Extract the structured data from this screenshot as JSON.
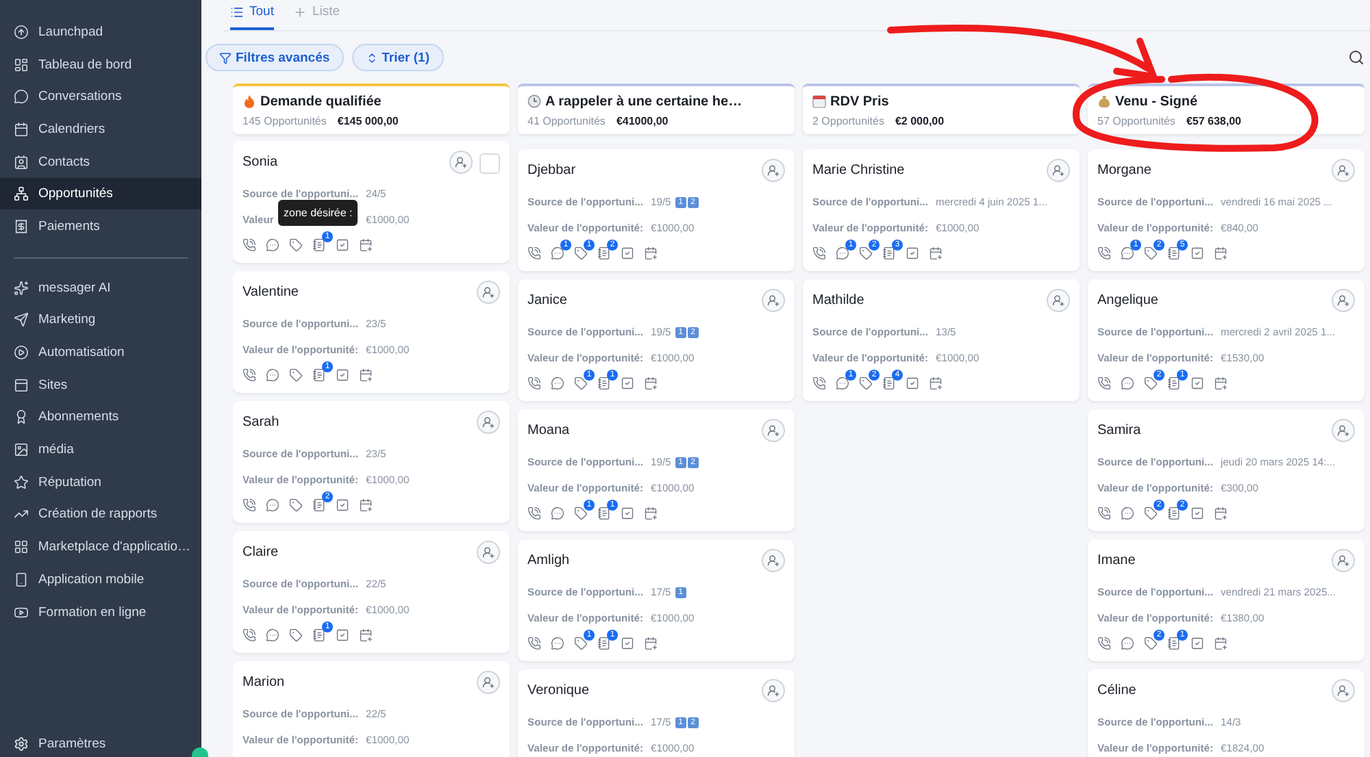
{
  "sidebar": {
    "sections": [
      {
        "items": [
          {
            "label": "Launchpad",
            "selected": false
          },
          {
            "label": "Tableau de bord",
            "selected": false
          },
          {
            "label": "Conversations",
            "selected": false
          },
          {
            "label": "Calendriers",
            "selected": false
          },
          {
            "label": "Contacts",
            "selected": false
          },
          {
            "label": "Opportunités",
            "selected": true
          },
          {
            "label": "Paiements",
            "selected": false
          }
        ]
      },
      {
        "items": [
          {
            "label": "messager AI",
            "selected": false
          },
          {
            "label": "Marketing",
            "selected": false
          },
          {
            "label": "Automatisation",
            "selected": false
          },
          {
            "label": "Sites",
            "selected": false
          },
          {
            "label": "Abonnements",
            "selected": false
          },
          {
            "label": "média",
            "selected": false
          },
          {
            "label": "Réputation",
            "selected": false
          },
          {
            "label": "Création de rapports",
            "selected": false
          },
          {
            "label": "Marketplace d'applicatio…",
            "selected": false
          },
          {
            "label": "Application mobile",
            "selected": false
          },
          {
            "label": "Formation en ligne",
            "selected": false
          }
        ]
      }
    ],
    "footer": {
      "label": "Paramètres"
    }
  },
  "tabs": [
    {
      "label": "Tout",
      "selected": true
    },
    {
      "label": "Liste",
      "selected": false
    }
  ],
  "toolbar": {
    "buttons": [
      {
        "label": "Filtres avancés",
        "kind": "filter"
      },
      {
        "label": "Trier (1)",
        "kind": "sort"
      }
    ]
  },
  "columns": [
    {
      "title": "Demande qualifiée",
      "kind": "fire",
      "count": "145 Opportunités",
      "total": "€145 000,00",
      "cards": [
        {
          "name": "Sonia",
          "checkbox": false,
          "source_label": "Source de l'opportuni...",
          "source": "24/5",
          "value_label": "Valeur",
          "value": "€1000,00",
          "tooltip": "zone désirée :",
          "actions": [
            {
              "kind": "phone"
            },
            {
              "kind": "chat"
            },
            {
              "kind": "tag"
            },
            {
              "kind": "note",
              "count": "1"
            },
            {
              "kind": "task"
            },
            {
              "kind": "event"
            }
          ]
        },
        {
          "name": "Valentine",
          "source_label": "Source de l'opportuni...",
          "source": "23/5",
          "value_label": "Valeur de l'opportunité:",
          "value": "€1000,00",
          "actions": [
            {
              "kind": "phone"
            },
            {
              "kind": "chat"
            },
            {
              "kind": "tag"
            },
            {
              "kind": "note",
              "count": "1"
            },
            {
              "kind": "task"
            },
            {
              "kind": "event"
            }
          ]
        },
        {
          "name": "Sarah",
          "source_label": "Source de l'opportuni...",
          "source": "23/5",
          "value_label": "Valeur de l'opportunité:",
          "value": "€1000,00",
          "actions": [
            {
              "kind": "phone"
            },
            {
              "kind": "chat"
            },
            {
              "kind": "tag"
            },
            {
              "kind": "note",
              "count": "2"
            },
            {
              "kind": "task"
            },
            {
              "kind": "event"
            }
          ]
        },
        {
          "name": "Claire",
          "source_label": "Source de l'opportuni...",
          "source": "22/5",
          "value_label": "Valeur de l'opportunité:",
          "value": "€1000,00",
          "actions": [
            {
              "kind": "phone"
            },
            {
              "kind": "chat"
            },
            {
              "kind": "tag"
            },
            {
              "kind": "note",
              "count": "1"
            },
            {
              "kind": "task"
            },
            {
              "kind": "event"
            }
          ]
        },
        {
          "name": "Marion",
          "source_label": "Source de l'opportuni...",
          "source": "22/5",
          "value_label": "Valeur de l'opportunité:",
          "value": "€1000,00"
        }
      ]
    },
    {
      "title": "A rappeler à une certaine he…",
      "kind": "clock",
      "count": "41 Opportunités",
      "total": "€41000,00",
      "cards": [
        {
          "name": "Djebbar",
          "source_label": "Source de l'opportuni...",
          "source": "19/5",
          "tags": [
            "1",
            "2"
          ],
          "value_label": "Valeur de l'opportunité:",
          "value": "€1000,00",
          "actions": [
            {
              "kind": "phone"
            },
            {
              "kind": "chat",
              "count": "1"
            },
            {
              "kind": "tag",
              "count": "1"
            },
            {
              "kind": "note",
              "count": "2"
            },
            {
              "kind": "task"
            },
            {
              "kind": "event"
            }
          ]
        },
        {
          "name": "Janice",
          "source_label": "Source de l'opportuni...",
          "source": "19/5",
          "tags": [
            "1",
            "2"
          ],
          "value_label": "Valeur de l'opportunité:",
          "value": "€1000,00",
          "actions": [
            {
              "kind": "phone"
            },
            {
              "kind": "chat"
            },
            {
              "kind": "tag",
              "count": "1"
            },
            {
              "kind": "note",
              "count": "1"
            },
            {
              "kind": "task"
            },
            {
              "kind": "event"
            }
          ]
        },
        {
          "name": "Moana",
          "source_label": "Source de l'opportuni...",
          "source": "19/5",
          "tags": [
            "1",
            "2"
          ],
          "value_label": "Valeur de l'opportunité:",
          "value": "€1000,00",
          "actions": [
            {
              "kind": "phone"
            },
            {
              "kind": "chat"
            },
            {
              "kind": "tag",
              "count": "1"
            },
            {
              "kind": "note",
              "count": "1"
            },
            {
              "kind": "task"
            },
            {
              "kind": "event"
            }
          ]
        },
        {
          "name": "Amligh",
          "source_label": "Source de l'opportuni...",
          "source": "17/5",
          "tags": [
            "1"
          ],
          "value_label": "Valeur de l'opportunité:",
          "value": "€1000,00",
          "actions": [
            {
              "kind": "phone"
            },
            {
              "kind": "chat"
            },
            {
              "kind": "tag",
              "count": "1"
            },
            {
              "kind": "note",
              "count": "1"
            },
            {
              "kind": "task"
            },
            {
              "kind": "event"
            }
          ]
        },
        {
          "name": "Veronique",
          "source_label": "Source de l'opportuni...",
          "source": "17/5",
          "tags": [
            "1",
            "2"
          ],
          "value_label": "Valeur de l'opportunité:",
          "value": "€1000,00"
        }
      ]
    },
    {
      "title": "RDV Pris",
      "kind": "calendar",
      "count": "2 Opportunités",
      "total": "€2 000,00",
      "cards": [
        {
          "name": "Marie Christine",
          "source_label": "Source de l'opportuni...",
          "source": "mercredi 4 juin 2025 1...",
          "value_label": "Valeur de l'opportunité:",
          "value": "€1000,00",
          "actions": [
            {
              "kind": "phone"
            },
            {
              "kind": "chat",
              "count": "1"
            },
            {
              "kind": "tag",
              "count": "2"
            },
            {
              "kind": "note",
              "count": "3"
            },
            {
              "kind": "task"
            },
            {
              "kind": "event"
            }
          ]
        },
        {
          "name": "Mathilde",
          "source_label": "Source de l'opportuni...",
          "source": "13/5",
          "value_label": "Valeur de l'opportunité:",
          "value": "€1000,00",
          "actions": [
            {
              "kind": "phone"
            },
            {
              "kind": "chat",
              "count": "1"
            },
            {
              "kind": "tag",
              "count": "2"
            },
            {
              "kind": "note",
              "count": "4"
            },
            {
              "kind": "task"
            },
            {
              "kind": "event"
            }
          ]
        }
      ]
    },
    {
      "title": "Venu - Signé",
      "kind": "money",
      "count": "57 Opportunités",
      "total": "€57 638,00",
      "cards": [
        {
          "name": "Morgane",
          "source_label": "Source de l'opportuni...",
          "source": "vendredi 16 mai 2025 ...",
          "value_label": "Valeur de l'opportunité:",
          "value": "€840,00",
          "actions": [
            {
              "kind": "phone"
            },
            {
              "kind": "chat",
              "count": "1"
            },
            {
              "kind": "tag",
              "count": "2"
            },
            {
              "kind": "note",
              "count": "5"
            },
            {
              "kind": "task"
            },
            {
              "kind": "event"
            }
          ]
        },
        {
          "name": "Angelique",
          "source_label": "Source de l'opportuni...",
          "source": "mercredi 2 avril 2025 1...",
          "value_label": "Valeur de l'opportunité:",
          "value": "€1530,00",
          "actions": [
            {
              "kind": "phone"
            },
            {
              "kind": "chat"
            },
            {
              "kind": "tag",
              "count": "2"
            },
            {
              "kind": "note",
              "count": "1"
            },
            {
              "kind": "task"
            },
            {
              "kind": "event"
            }
          ]
        },
        {
          "name": "Samira",
          "source_label": "Source de l'opportuni...",
          "source": "jeudi 20 mars 2025 14:...",
          "value_label": "Valeur de l'opportunité:",
          "value": "€300,00",
          "actions": [
            {
              "kind": "phone"
            },
            {
              "kind": "chat"
            },
            {
              "kind": "tag",
              "count": "2"
            },
            {
              "kind": "note",
              "count": "2"
            },
            {
              "kind": "task"
            },
            {
              "kind": "event"
            }
          ]
        },
        {
          "name": "Imane",
          "source_label": "Source de l'opportuni...",
          "source": "vendredi 21 mars 2025...",
          "value_label": "Valeur de l'opportunité:",
          "value": "€1380,00",
          "actions": [
            {
              "kind": "phone"
            },
            {
              "kind": "chat"
            },
            {
              "kind": "tag",
              "count": "2"
            },
            {
              "kind": "note",
              "count": "1"
            },
            {
              "kind": "task"
            },
            {
              "kind": "event"
            }
          ]
        },
        {
          "name": "Céline",
          "source_label": "Source de l'opportuni...",
          "source": "14/3",
          "value_label": "Valeur de l'opportunité:",
          "value": "€1824,00"
        }
      ]
    }
  ]
}
